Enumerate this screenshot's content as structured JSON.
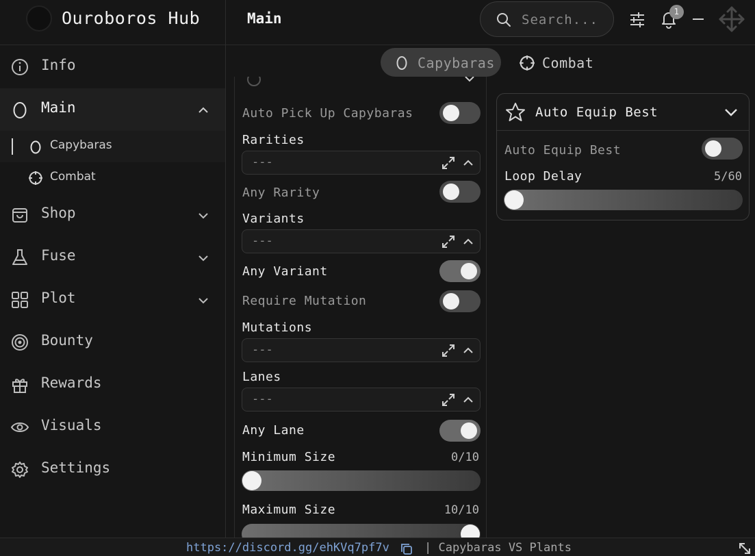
{
  "header": {
    "app_title": "Ouroboros Hub",
    "page_title": "Main",
    "search_placeholder": "Search...",
    "notification_count": "1"
  },
  "sidebar": {
    "items": [
      {
        "label": "Info",
        "icon": "info-icon"
      },
      {
        "label": "Main",
        "icon": "egg-icon",
        "expanded": true
      },
      {
        "label": "Shop",
        "icon": "bag-icon"
      },
      {
        "label": "Fuse",
        "icon": "flask-icon"
      },
      {
        "label": "Plot",
        "icon": "grid-icon"
      },
      {
        "label": "Bounty",
        "icon": "target-icon"
      },
      {
        "label": "Rewards",
        "icon": "gift-icon"
      },
      {
        "label": "Visuals",
        "icon": "eye-icon"
      },
      {
        "label": "Settings",
        "icon": "gear-icon"
      }
    ],
    "sub_items": [
      {
        "label": "Capybaras",
        "icon": "egg-icon",
        "active": true
      },
      {
        "label": "Combat",
        "icon": "crosshair-icon"
      }
    ]
  },
  "tabs": [
    {
      "label": "Capybaras",
      "active": true
    },
    {
      "label": "Combat",
      "active": false
    }
  ],
  "left_panel": {
    "auto_pickup_label": "Auto Pick Up Capybaras",
    "auto_pickup_on": false,
    "rarities_label": "Rarities",
    "rarities_value": "---",
    "any_rarity_label": "Any Rarity",
    "any_rarity_on": false,
    "variants_label": "Variants",
    "variants_value": "---",
    "any_variant_label": "Any Variant",
    "any_variant_on": true,
    "require_mutation_label": "Require Mutation",
    "require_mutation_on": false,
    "mutations_label": "Mutations",
    "mutations_value": "---",
    "lanes_label": "Lanes",
    "lanes_value": "---",
    "any_lane_label": "Any Lane",
    "any_lane_on": true,
    "min_size_label": "Minimum Size",
    "min_size_value": "0/10",
    "min_size_fraction": 0,
    "max_size_label": "Maximum Size",
    "max_size_value": "10/10",
    "max_size_fraction": 1
  },
  "right_card": {
    "title": "Auto Equip Best",
    "icon": "star-icon",
    "toggle_label": "Auto Equip Best",
    "toggle_on": false,
    "loop_delay_label": "Loop Delay",
    "loop_delay_value": "5/60",
    "loop_delay_fraction": 0.0
  },
  "footer": {
    "link": "https://discord.gg/ehKVq7pf7v",
    "game": "| Capybaras VS Plants"
  }
}
